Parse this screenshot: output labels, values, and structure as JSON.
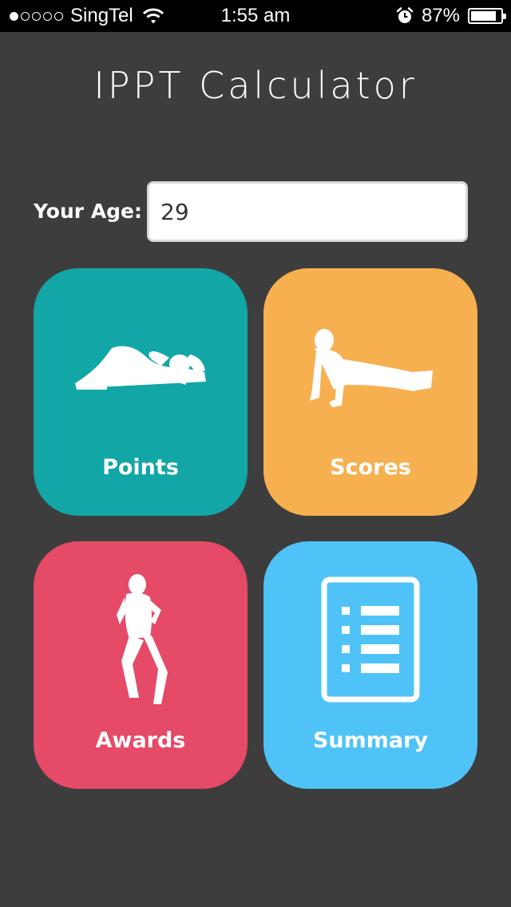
{
  "status_bar": {
    "carrier": "SingTel",
    "signal_bars": 1,
    "time": "1:55 am",
    "battery_percent": "87%",
    "battery_level": 0.87,
    "icons": [
      "signal-dots-icon",
      "wifi-icon",
      "alarm-clock-icon",
      "battery-icon"
    ]
  },
  "app": {
    "title": "IPPT Calculator"
  },
  "age": {
    "label": "Your Age:",
    "value": "29"
  },
  "tiles": [
    {
      "label": "Points",
      "color": "#12a6a6",
      "icon": "situp-icon"
    },
    {
      "label": "Scores",
      "color": "#f7b04f",
      "icon": "pushup-icon"
    },
    {
      "label": "Awards",
      "color": "#e54a66",
      "icon": "runner-icon"
    },
    {
      "label": "Summary",
      "color": "#4fc3f7",
      "icon": "document-list-icon"
    }
  ],
  "colors": {
    "background": "#3d3d3d",
    "status_bar": "#000000"
  }
}
